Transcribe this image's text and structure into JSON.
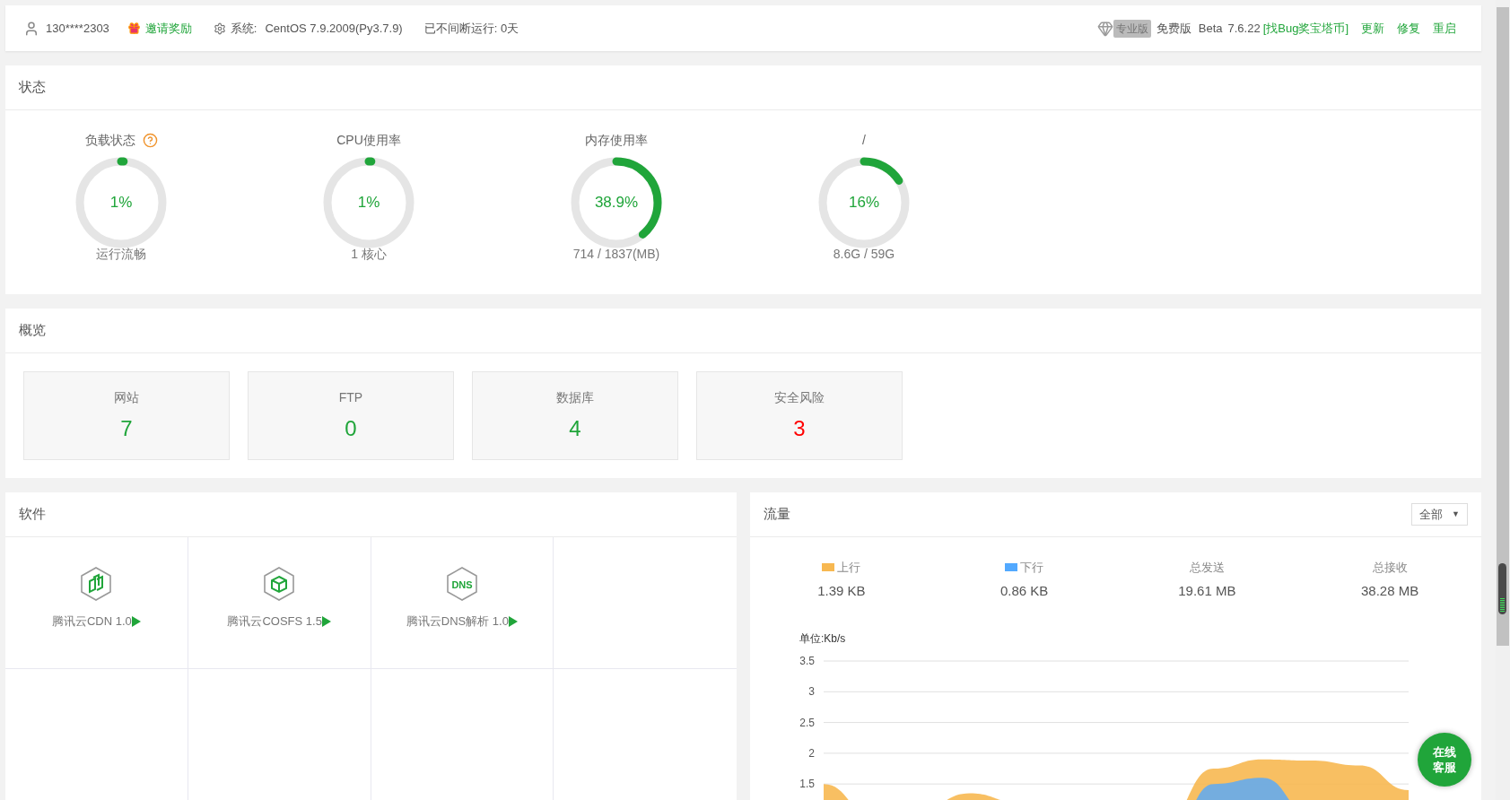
{
  "top_bar": {
    "user": "130****2303",
    "invite": "邀请奖励",
    "system_label": "系统:",
    "system": "CentOS 7.9.2009(Py3.7.9)",
    "uptime": "已不间断运行: 0天",
    "pro_badge": "专业版",
    "edition": "免费版",
    "channel": "Beta",
    "version": "7.6.22",
    "bug_link": "[找Bug奖宝塔币]",
    "actions": [
      "更新",
      "修复",
      "重启"
    ]
  },
  "status": {
    "title": "状态",
    "gauges": [
      {
        "label": "负载状态",
        "help": true,
        "value": "1%",
        "level": 0.01,
        "caption": "运行流畅"
      },
      {
        "label": "CPU使用率",
        "help": false,
        "value": "1%",
        "level": 0.01,
        "caption": "1 核心"
      },
      {
        "label": "内存使用率",
        "help": false,
        "value": "38.9%",
        "level": 0.389,
        "caption": "714 / 1837(MB)"
      },
      {
        "label": "/",
        "help": false,
        "value": "16%",
        "level": 0.16,
        "caption": "8.6G / 59G"
      }
    ]
  },
  "overview": {
    "title": "概览",
    "cards": [
      {
        "label": "网站",
        "value": "7",
        "color": "#20a53a"
      },
      {
        "label": "FTP",
        "value": "0",
        "color": "#20a53a"
      },
      {
        "label": "数据库",
        "value": "4",
        "color": "#20a53a"
      },
      {
        "label": "安全风险",
        "value": "3",
        "color": "#ff0000"
      }
    ]
  },
  "software": {
    "title": "软件",
    "items": [
      {
        "name": "腾讯云CDN 1.0",
        "kind": "cdn"
      },
      {
        "name": "腾讯云COSFS 1.5",
        "kind": "cosfs"
      },
      {
        "name": "腾讯云DNS解析 1.0",
        "kind": "dns",
        "icon_text": "DNS"
      }
    ]
  },
  "traffic": {
    "title": "流量",
    "filter": "全部",
    "filter_arrow": "▼",
    "stats": [
      {
        "kind": "legend",
        "value": "1.39 KB"
      },
      {
        "kind": "legend",
        "value": "0.86 KB"
      },
      {
        "kind": "total",
        "label": "总发送",
        "value": "19.61 MB"
      },
      {
        "kind": "total",
        "label": "总接收",
        "value": "38.28 MB"
      }
    ],
    "chart_data": {
      "type": "area",
      "ylabel": "单位:Kb/s",
      "ylim": [
        0,
        3.5
      ],
      "yticks": [
        1.5,
        2,
        2.5,
        3,
        3.5
      ],
      "grid": true,
      "series": [
        {
          "name": "上行",
          "color": "#f7b851",
          "values": [
            1.5,
            1.0,
            1.1,
            1.35,
            1.2,
            0.8,
            0.7,
            0.9,
            1.75,
            1.9,
            1.88,
            1.8,
            1.4
          ]
        },
        {
          "name": "下行",
          "color": "#52a9ff",
          "values": [
            0.5,
            0.4,
            0.5,
            0.6,
            0.5,
            0.4,
            0.3,
            0.4,
            1.5,
            1.6,
            1.0,
            0.6,
            0.5
          ]
        }
      ]
    }
  },
  "chat_button": "在线客服"
}
